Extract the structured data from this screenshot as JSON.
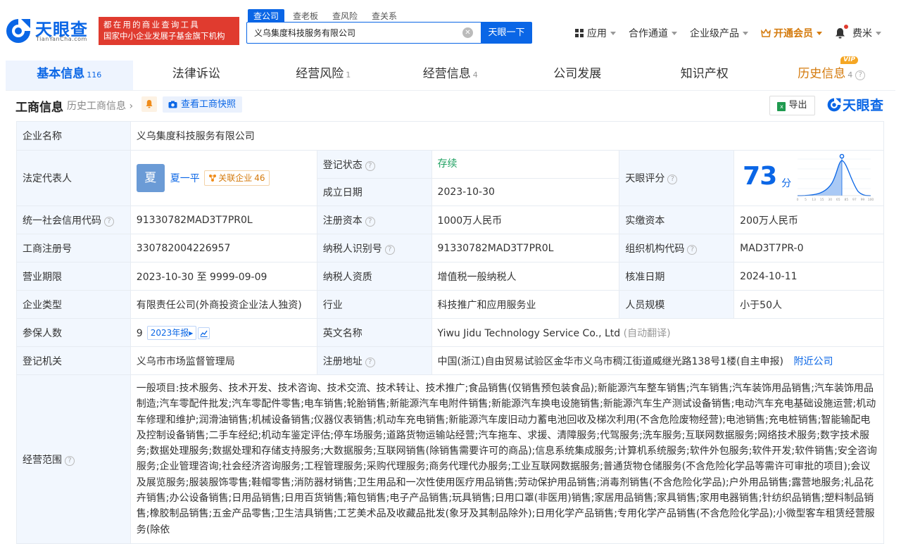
{
  "header": {
    "logo_cn": "天眼查",
    "logo_en": "TianYanCha.com",
    "slogan_line1": "都在用的商业查询工具",
    "slogan_line2": "国家中小企业发展子基金旗下机构",
    "search_tabs": [
      "查公司",
      "查老板",
      "查风险",
      "查关系"
    ],
    "search_value": "义乌集度科技服务有限公司",
    "search_button": "天眼一下",
    "nav": {
      "apps": "应用",
      "channel": "合作通道",
      "enterprise": "企业级产品",
      "vip": "开通会员",
      "user": "费米"
    }
  },
  "tabs": [
    {
      "label": "基本信息",
      "count": "116"
    },
    {
      "label": "法律诉讼",
      "count": ""
    },
    {
      "label": "经营风险",
      "count": "1"
    },
    {
      "label": "经营信息",
      "count": "4"
    },
    {
      "label": "公司发展",
      "count": ""
    },
    {
      "label": "知识产权",
      "count": ""
    },
    {
      "label": "历史信息",
      "count": "4",
      "badge": "VIP"
    }
  ],
  "section": {
    "title": "工商信息",
    "history_link": "历史工商信息",
    "snapshot_button": "查看工商快照",
    "export_button": "导出",
    "brand": "天眼查"
  },
  "info": {
    "company_name_label": "企业名称",
    "company_name": "义乌集度科技服务有限公司",
    "legal_rep_label": "法定代表人",
    "legal_rep_avatar": "夏",
    "legal_rep": "夏一平",
    "assoc_label": "关联企业",
    "assoc_count": "46",
    "reg_status_label": "登记状态",
    "reg_status": "存续",
    "found_date_label": "成立日期",
    "found_date": "2023-10-30",
    "score_label": "天眼评分",
    "score": "73",
    "score_unit": "分",
    "score_axis": [
      "0",
      "5",
      "13",
      "15",
      "30",
      "65",
      "85",
      "97",
      "99",
      "100"
    ],
    "credit_code_label": "统一社会信用代码",
    "credit_code": "91330782MAD3T7PR0L",
    "reg_capital_label": "注册资本",
    "reg_capital": "1000万人民币",
    "paid_capital_label": "实缴资本",
    "paid_capital": "200万人民币",
    "reg_no_label": "工商注册号",
    "reg_no": "330782004226957",
    "taxpayer_id_label": "纳税人识别号",
    "taxpayer_id": "91330782MAD3T7PR0L",
    "org_code_label": "组织机构代码",
    "org_code": "MAD3T7PR-0",
    "term_label": "营业期限",
    "term": "2023-10-30 至 9999-09-09",
    "taxpayer_qual_label": "纳税人资质",
    "taxpayer_qual": "增值税一般纳税人",
    "approve_date_label": "核准日期",
    "approve_date": "2024-10-11",
    "type_label": "企业类型",
    "type": "有限责任公司(外商投资企业法人独资)",
    "industry_label": "行业",
    "industry": "科技推广和应用服务业",
    "staff_label": "人员规模",
    "staff": "小于50人",
    "insured_label": "参保人数",
    "insured": "9",
    "insured_year": "2023年报",
    "en_name_label": "英文名称",
    "en_name": "Yiwu Jidu Technology Service Co., Ltd",
    "en_name_note": "(自动翻译)",
    "authority_label": "登记机关",
    "authority": "义乌市市场监督管理局",
    "address_label": "注册地址",
    "address": "中国(浙江)自由贸易试验区金华市义乌市稠江街道威继光路138号1楼(自主申报)",
    "nearby_link": "附近公司",
    "scope_label": "经营范围",
    "scope": "一般项目:技术服务、技术开发、技术咨询、技术交流、技术转让、技术推广;食品销售(仅销售预包装食品);新能源汽车整车销售;汽车销售;汽车装饰用品销售;汽车装饰用品制造;汽车零配件批发;汽车零配件零售;电车销售;轮胎销售;新能源汽车电附件销售;新能源汽车换电设施销售;新能源汽车生产测试设备销售;电动汽车充电基础设施运营;机动车修理和维护;润滑油销售;机械设备销售;仪器仪表销售;机动车充电销售;新能源汽车废旧动力蓄电池回收及梯次利用(不含危险废物经营);电池销售;充电桩销售;智能输配电及控制设备销售;二手车经纪;机动车鉴定评估;停车场服务;道路货物运输站经营;汽车拖车、求援、清障服务;代驾服务;洗车服务;互联网数据服务;网络技术服务;数字技术服务;数据处理服务;数据处理和存储支持服务;大数据服务;互联网销售(除销售需要许可的商品);信息系统集成服务;计算机系统服务;软件外包服务;软件开发;软件销售;安全咨询服务;企业管理咨询;社会经济咨询服务;工程管理服务;采购代理服务;商务代理代办服务;工业互联网数据服务;普通货物仓储服务(不含危险化学品等需许可审批的项目);会议及展览服务;服装服饰零售;鞋帽零售;消防器材销售;卫生用品和一次性使用医疗用品销售;劳动保护用品销售;消毒剂销售(不含危险化学品);户外用品销售;露营地服务;礼品花卉销售;办公设备销售;日用品销售;日用百货销售;箱包销售;电子产品销售;玩具销售;日用口罩(非医用)销售;家居用品销售;家具销售;家用电器销售;针纺织品销售;塑料制品销售;橡胶制品销售;五金产品零售;卫生洁具销售;工艺美术品及收藏品批发(象牙及其制品除外);日用化学产品销售;专用化学产品销售(不含危险化学品);小微型客车租赁经营服务(除依"
  },
  "colors": {
    "brand_blue": "#0a66e6",
    "slogan_red": "#e03b2f",
    "vip_orange": "#d47a0c",
    "status_green": "#20a162",
    "label_bg": "#f2f7fe"
  }
}
